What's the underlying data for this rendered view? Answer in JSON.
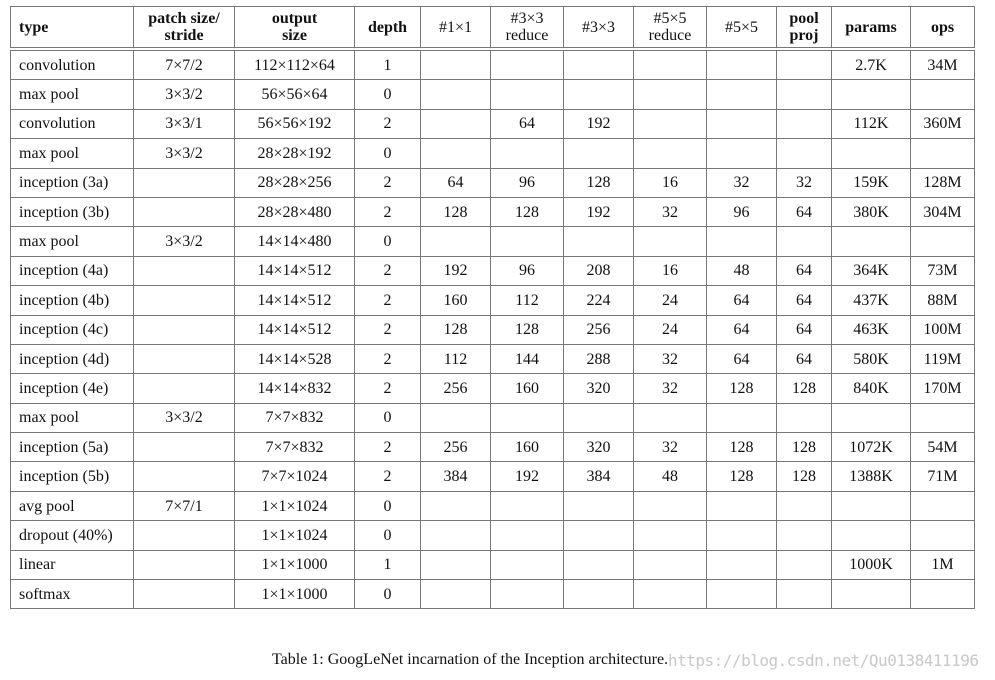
{
  "table": {
    "columns": [
      {
        "lines": [
          "type"
        ],
        "bold": true
      },
      {
        "lines": [
          "patch size/",
          "stride"
        ],
        "bold": true
      },
      {
        "lines": [
          "output",
          "size"
        ],
        "bold": true
      },
      {
        "lines": [
          "depth"
        ],
        "bold": true
      },
      {
        "lines": [
          "#1×1"
        ],
        "bold": false
      },
      {
        "lines": [
          "#3×3",
          "reduce"
        ],
        "bold": false
      },
      {
        "lines": [
          "#3×3"
        ],
        "bold": false
      },
      {
        "lines": [
          "#5×5",
          "reduce"
        ],
        "bold": false
      },
      {
        "lines": [
          "#5×5"
        ],
        "bold": false
      },
      {
        "lines": [
          "pool",
          "proj"
        ],
        "bold": true
      },
      {
        "lines": [
          "params"
        ],
        "bold": true
      },
      {
        "lines": [
          "ops"
        ],
        "bold": true
      }
    ],
    "rows": [
      [
        "convolution",
        "7×7/2",
        "112×112×64",
        "1",
        "",
        "",
        "",
        "",
        "",
        "",
        "2.7K",
        "34M"
      ],
      [
        "max pool",
        "3×3/2",
        "56×56×64",
        "0",
        "",
        "",
        "",
        "",
        "",
        "",
        "",
        ""
      ],
      [
        "convolution",
        "3×3/1",
        "56×56×192",
        "2",
        "",
        "64",
        "192",
        "",
        "",
        "",
        "112K",
        "360M"
      ],
      [
        "max pool",
        "3×3/2",
        "28×28×192",
        "0",
        "",
        "",
        "",
        "",
        "",
        "",
        "",
        ""
      ],
      [
        "inception (3a)",
        "",
        "28×28×256",
        "2",
        "64",
        "96",
        "128",
        "16",
        "32",
        "32",
        "159K",
        "128M"
      ],
      [
        "inception (3b)",
        "",
        "28×28×480",
        "2",
        "128",
        "128",
        "192",
        "32",
        "96",
        "64",
        "380K",
        "304M"
      ],
      [
        "max pool",
        "3×3/2",
        "14×14×480",
        "0",
        "",
        "",
        "",
        "",
        "",
        "",
        "",
        ""
      ],
      [
        "inception (4a)",
        "",
        "14×14×512",
        "2",
        "192",
        "96",
        "208",
        "16",
        "48",
        "64",
        "364K",
        "73M"
      ],
      [
        "inception (4b)",
        "",
        "14×14×512",
        "2",
        "160",
        "112",
        "224",
        "24",
        "64",
        "64",
        "437K",
        "88M"
      ],
      [
        "inception (4c)",
        "",
        "14×14×512",
        "2",
        "128",
        "128",
        "256",
        "24",
        "64",
        "64",
        "463K",
        "100M"
      ],
      [
        "inception (4d)",
        "",
        "14×14×528",
        "2",
        "112",
        "144",
        "288",
        "32",
        "64",
        "64",
        "580K",
        "119M"
      ],
      [
        "inception (4e)",
        "",
        "14×14×832",
        "2",
        "256",
        "160",
        "320",
        "32",
        "128",
        "128",
        "840K",
        "170M"
      ],
      [
        "max pool",
        "3×3/2",
        "7×7×832",
        "0",
        "",
        "",
        "",
        "",
        "",
        "",
        "",
        ""
      ],
      [
        "inception (5a)",
        "",
        "7×7×832",
        "2",
        "256",
        "160",
        "320",
        "32",
        "128",
        "128",
        "1072K",
        "54M"
      ],
      [
        "inception (5b)",
        "",
        "7×7×1024",
        "2",
        "384",
        "192",
        "384",
        "48",
        "128",
        "128",
        "1388K",
        "71M"
      ],
      [
        "avg pool",
        "7×7/1",
        "1×1×1024",
        "0",
        "",
        "",
        "",
        "",
        "",
        "",
        "",
        ""
      ],
      [
        "dropout (40%)",
        "",
        "1×1×1024",
        "0",
        "",
        "",
        "",
        "",
        "",
        "",
        "",
        ""
      ],
      [
        "linear",
        "",
        "1×1×1000",
        "1",
        "",
        "",
        "",
        "",
        "",
        "",
        "1000K",
        "1M"
      ],
      [
        "softmax",
        "",
        "1×1×1000",
        "0",
        "",
        "",
        "",
        "",
        "",
        "",
        "",
        ""
      ]
    ]
  },
  "caption": "Table 1: GoogLeNet incarnation of the Inception architecture.",
  "watermark": "https://blog.csdn.net/Qu0138411196"
}
